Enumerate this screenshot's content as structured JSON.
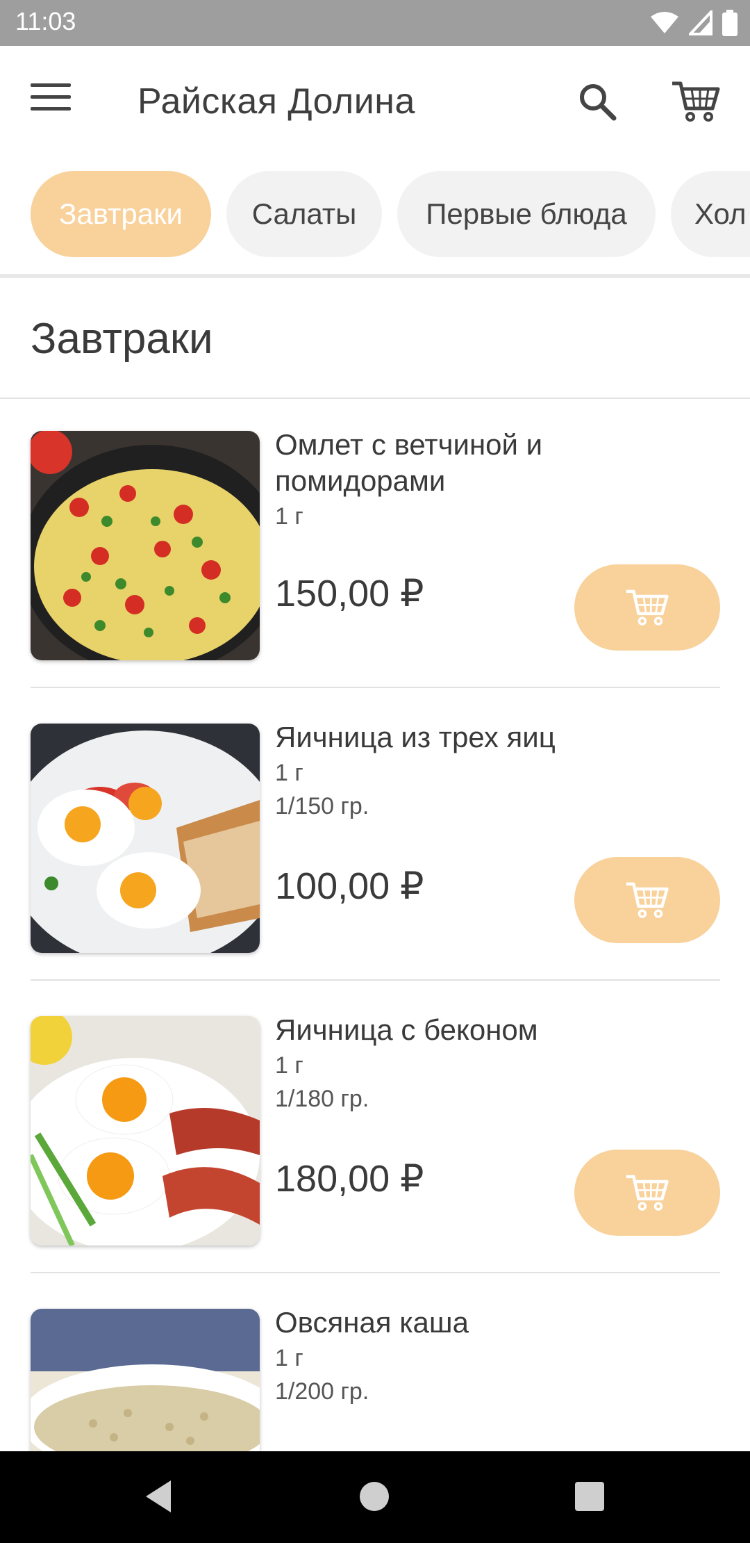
{
  "status_bar": {
    "time": "11:03"
  },
  "app_bar": {
    "title": "Райская Долина"
  },
  "categories": [
    {
      "label": "Завтраки",
      "active": true
    },
    {
      "label": "Салаты",
      "active": false
    },
    {
      "label": "Первые блюда",
      "active": false
    },
    {
      "label": "Хол",
      "active": false
    }
  ],
  "section": {
    "title": "Завтраки"
  },
  "items": [
    {
      "name": "Омлет с ветчиной и помидорами",
      "qty": "1 г",
      "weight": "",
      "price": "150,00 ₽"
    },
    {
      "name": "Яичница из трех яиц",
      "qty": "1 г",
      "weight": "1/150 гр.",
      "price": "100,00 ₽"
    },
    {
      "name": "Яичница с беконом",
      "qty": "1 г",
      "weight": "1/180 гр.",
      "price": "180,00 ₽"
    },
    {
      "name": "Овсяная каша",
      "qty": "1 г",
      "weight": "1/200 гр.",
      "price": ""
    }
  ],
  "colors": {
    "accent": "#f8d19b",
    "chip_bg": "#f2f2f2",
    "status_bar": "#9e9e9e"
  },
  "icons": [
    "menu-icon",
    "search-icon",
    "cart-icon",
    "add-to-cart-icon",
    "back-icon",
    "home-icon",
    "recents-icon"
  ]
}
